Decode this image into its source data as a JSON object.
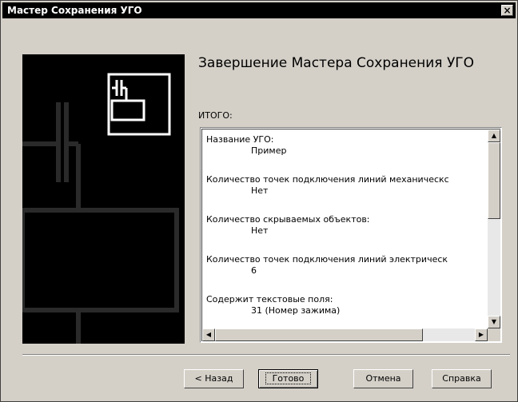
{
  "window": {
    "title": "Мастер Сохранения УГО",
    "close_glyph": "×"
  },
  "main": {
    "heading": "Завершение Мастера Сохранения УГО",
    "summary_label": "ИТОГО:"
  },
  "summary_items": [
    {
      "label": "Название УГО:",
      "value": "Пример"
    },
    {
      "label": "Количество точек подключения линий механическс",
      "value": "Нет"
    },
    {
      "label": "Количество скрываемых объектов:",
      "value": "Нет"
    },
    {
      "label": "Количество точек подключения линий электрическ",
      "value": "6"
    },
    {
      "label": "Содержит текстовые поля:",
      "value": "31 (Номер зажима)"
    }
  ],
  "scroll": {
    "up": "▲",
    "down": "▼",
    "left": "◀",
    "right": "▶"
  },
  "buttons": {
    "back": "< Назад",
    "finish": "Готово",
    "cancel": "Отмена",
    "help": "Справка"
  },
  "icons": {
    "wizard_graphic": "capacitor-symbol-icon"
  }
}
